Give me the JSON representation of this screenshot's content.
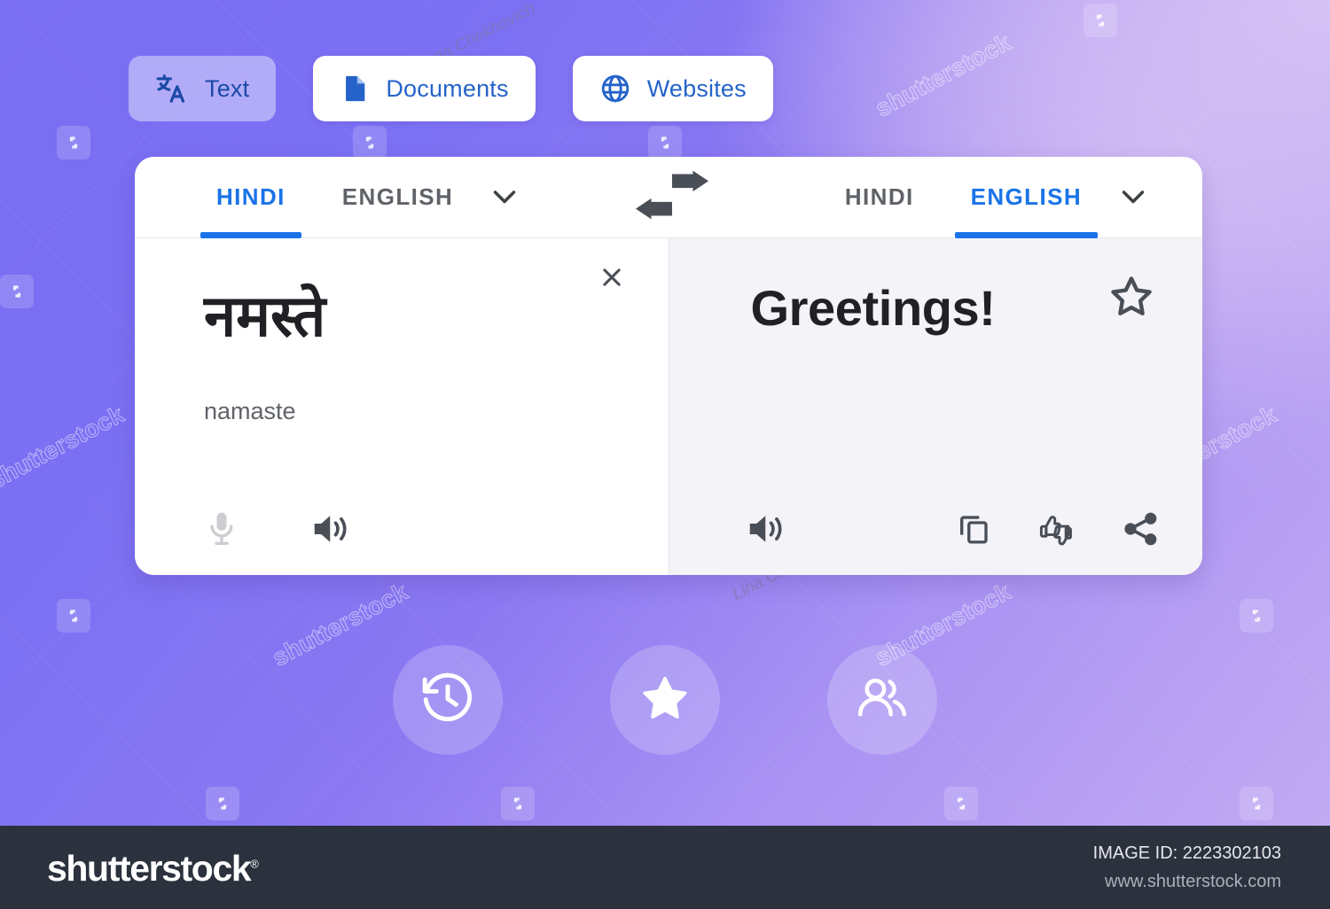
{
  "mode_tabs": [
    {
      "label": "Text",
      "icon": "translate-icon",
      "active": true
    },
    {
      "label": "Documents",
      "icon": "document-icon",
      "active": false
    },
    {
      "label": "Websites",
      "icon": "globe-icon",
      "active": false
    }
  ],
  "language_bar": {
    "source": {
      "options": [
        "HINDI",
        "ENGLISH"
      ],
      "selected": "HINDI",
      "dropdown_icon": "chevron-down-icon"
    },
    "swap_icon": "swap-arrows-icon",
    "target": {
      "options": [
        "HINDI",
        "ENGLISH"
      ],
      "selected": "ENGLISH",
      "dropdown_icon": "chevron-down-icon"
    }
  },
  "source_pane": {
    "text": "नमस्ते",
    "transliteration": "namaste",
    "clear_icon": "close-icon",
    "actions": [
      {
        "name": "microphone-icon",
        "state": "disabled"
      },
      {
        "name": "speaker-icon",
        "state": "enabled"
      }
    ]
  },
  "target_pane": {
    "text": "Greetings!",
    "favorite_icon": "star-outline-icon",
    "actions": [
      {
        "name": "speaker-icon",
        "state": "enabled"
      },
      {
        "name": "copy-icon",
        "state": "enabled"
      },
      {
        "name": "feedback-icon",
        "state": "enabled"
      },
      {
        "name": "share-icon",
        "state": "enabled"
      }
    ]
  },
  "quick_actions": [
    {
      "name": "history-icon",
      "label": "History"
    },
    {
      "name": "starred-icon",
      "label": "Saved"
    },
    {
      "name": "community-icon",
      "label": "Community"
    }
  ],
  "footer": {
    "logo": "shutterstock",
    "logo_mark": "®",
    "image_id": "IMAGE ID: 2223302103",
    "url": "www.shutterstock.com"
  },
  "watermarks": {
    "brand_text": "shutterstock",
    "signature": "Lina Chekhovich"
  },
  "colors": {
    "accent_blue": "#1a73e8",
    "button_blue": "#2563c9",
    "bg_purple_dark": "#6a63ee",
    "bg_purple_light": "#cfb8f0",
    "footer_dark": "#2b313d",
    "target_pane_bg": "#f4f3f8"
  }
}
